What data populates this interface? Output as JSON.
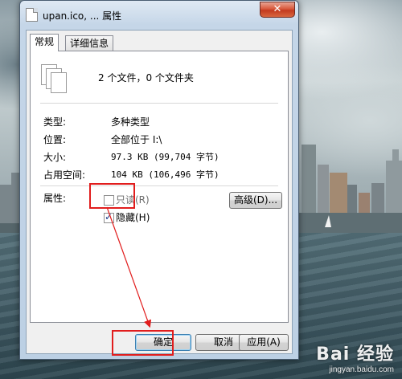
{
  "colors": {
    "annotation": "#e11d1d",
    "title_bar": "#c5d6e8",
    "close_button": "#c33a1f"
  },
  "window": {
    "title": "upan.ico, ... 属性",
    "close_glyph": "✕"
  },
  "tabs": [
    {
      "label": "常规",
      "active": true
    },
    {
      "label": "详细信息",
      "active": false
    }
  ],
  "general": {
    "summary": "2 个文件，0 个文件夹",
    "rows": [
      {
        "label": "类型:",
        "value": "多种类型"
      },
      {
        "label": "位置:",
        "value": "全部位于 I:\\"
      },
      {
        "label": "大小:",
        "value": "97.3 KB (99,704 字节)"
      },
      {
        "label": "占用空间:",
        "value": "104 KB (106,496 字节)"
      }
    ],
    "attributes_label": "属性:",
    "readonly": {
      "label": "只读(R)",
      "checked": false
    },
    "hidden": {
      "label": "隐藏(H)",
      "checked": true
    },
    "advanced_button": "高级(D)..."
  },
  "buttons": {
    "ok": "确定",
    "cancel": "取消",
    "apply": "应用(A)"
  },
  "watermark": {
    "brand": "Bai 经验",
    "url": "jingyan.baidu.com"
  }
}
